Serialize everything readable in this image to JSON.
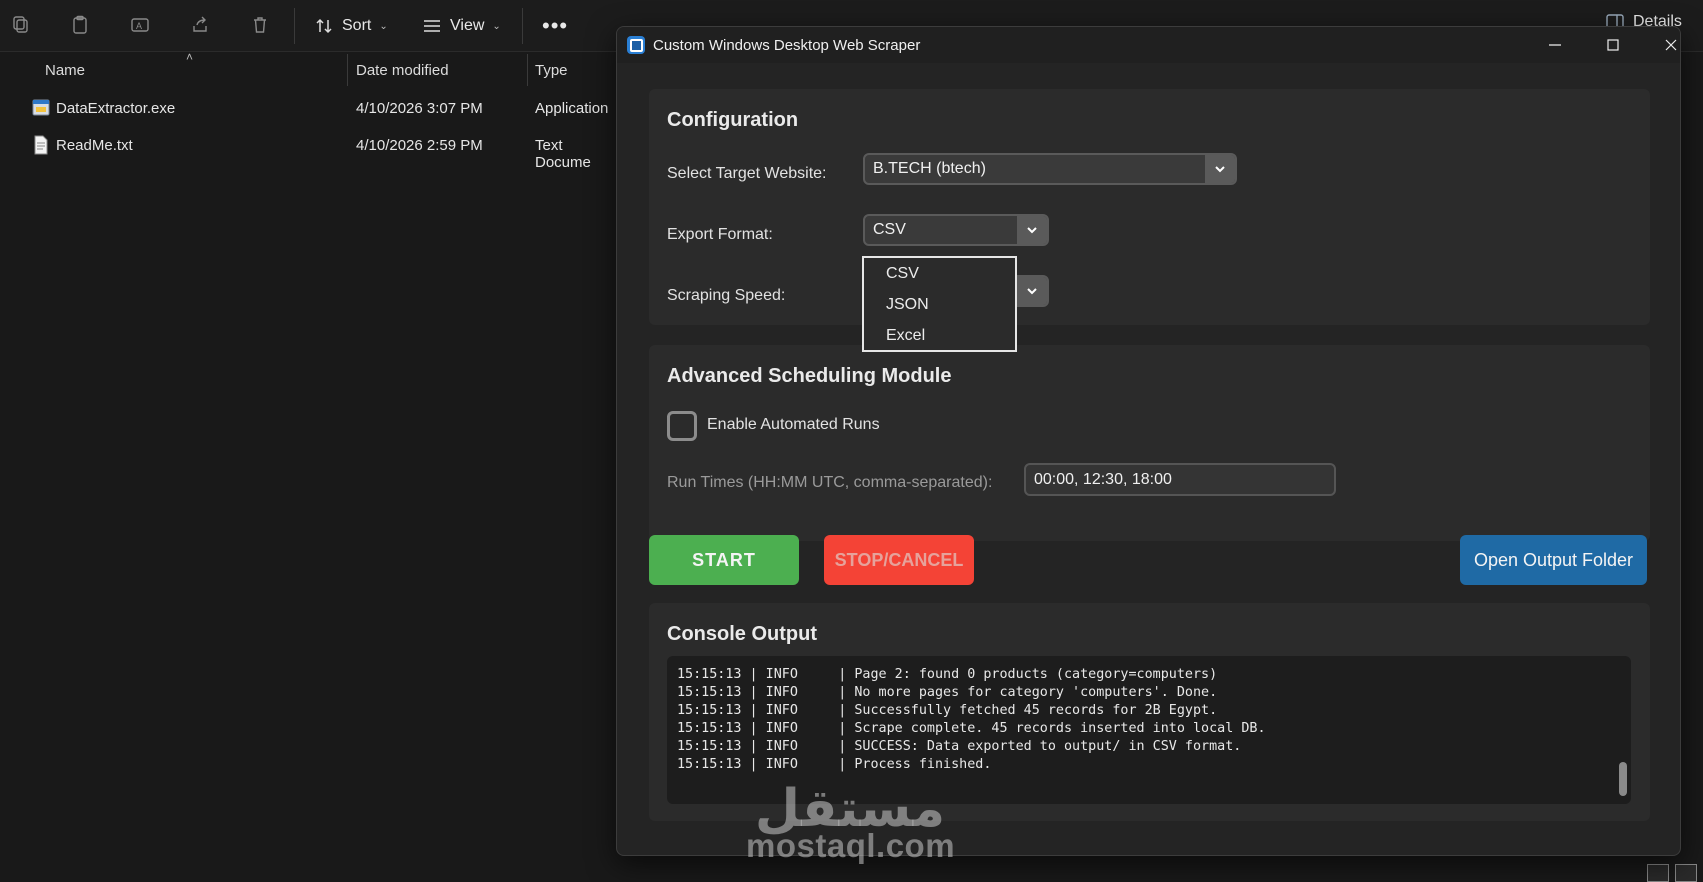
{
  "explorer": {
    "toolbar": {
      "sort_label": "Sort",
      "view_label": "View",
      "details_label": "Details"
    },
    "columns": {
      "name": "Name",
      "date_modified": "Date modified",
      "type": "Type"
    },
    "files": [
      {
        "name": "DataExtractor.exe",
        "date": "4/10/2026 3:07 PM",
        "type": "Application",
        "icon": "executable-file-icon"
      },
      {
        "name": "ReadMe.txt",
        "date": "4/10/2026 2:59 PM",
        "type": "Text Docume",
        "icon": "text-file-icon"
      }
    ]
  },
  "app": {
    "title": "Custom Windows Desktop Web Scraper",
    "configuration": {
      "heading": "Configuration",
      "target_label": "Select Target Website:",
      "target_value": "B.TECH (btech)",
      "format_label": "Export Format:",
      "format_value": "CSV",
      "speed_label": "Scraping Speed:",
      "format_options": [
        "CSV",
        "JSON",
        "Excel"
      ]
    },
    "scheduling": {
      "heading": "Advanced Scheduling Module",
      "enable_label": "Enable Automated Runs",
      "enable_checked": false,
      "run_times_label": "Run Times (HH:MM UTC, comma-separated):",
      "run_times_value": "00:00, 12:30, 18:00"
    },
    "buttons": {
      "start": "START",
      "stop": "STOP/CANCEL",
      "open_folder": "Open Output Folder"
    },
    "console": {
      "heading": "Console Output",
      "lines": [
        "15:15:13 | INFO     | Page 2: found 0 products (category=computers)",
        "15:15:13 | INFO     | No more pages for category 'computers'. Done.",
        "15:15:13 | INFO     | Successfully fetched 45 records for 2B Egypt.",
        "15:15:13 | INFO     | Scrape complete. 45 records inserted into local DB.",
        "15:15:13 | INFO     | SUCCESS: Data exported to output/ in CSV format.",
        "15:15:13 | INFO     | Process finished."
      ]
    }
  },
  "watermark": {
    "arabic": "مستقل",
    "latin": "mostaql.com"
  },
  "colors": {
    "start": "#4caf50",
    "stop": "#f44336",
    "open_folder": "#1f6aa5",
    "accent": "#2a7fd4"
  }
}
